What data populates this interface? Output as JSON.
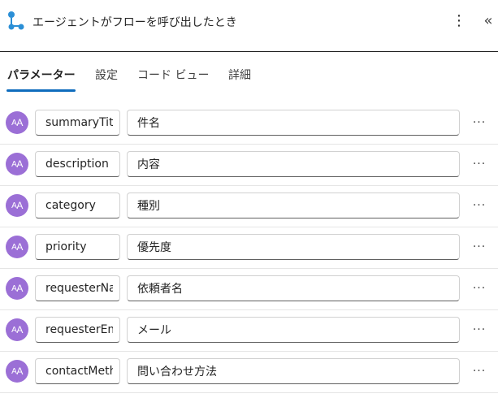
{
  "header": {
    "title": "エージェントがフローを呼び出したとき",
    "more_icon": "⋮",
    "collapse_icon": "«"
  },
  "tabs": [
    {
      "label": "パラメーター",
      "active": true
    },
    {
      "label": "設定",
      "active": false
    },
    {
      "label": "コード ビュー",
      "active": false
    },
    {
      "label": "詳細",
      "active": false
    }
  ],
  "colors": {
    "accent": "#0f6cbd",
    "avatar": "#9b6fd6",
    "trigger_icon": "#2b8fd6"
  },
  "parameters": [
    {
      "type_icon": "text-type-icon",
      "name": "summaryTitle",
      "description": "件名"
    },
    {
      "type_icon": "text-type-icon",
      "name": "description",
      "description": "内容"
    },
    {
      "type_icon": "text-type-icon",
      "name": "category",
      "description": "種別"
    },
    {
      "type_icon": "text-type-icon",
      "name": "priority",
      "description": "優先度"
    },
    {
      "type_icon": "text-type-icon",
      "name": "requesterName",
      "description": "依頼者名"
    },
    {
      "type_icon": "text-type-icon",
      "name": "requesterEmail",
      "description": "メール"
    },
    {
      "type_icon": "text-type-icon",
      "name": "contactMethod",
      "description": "問い合わせ方法"
    }
  ],
  "row_more_label": "···"
}
